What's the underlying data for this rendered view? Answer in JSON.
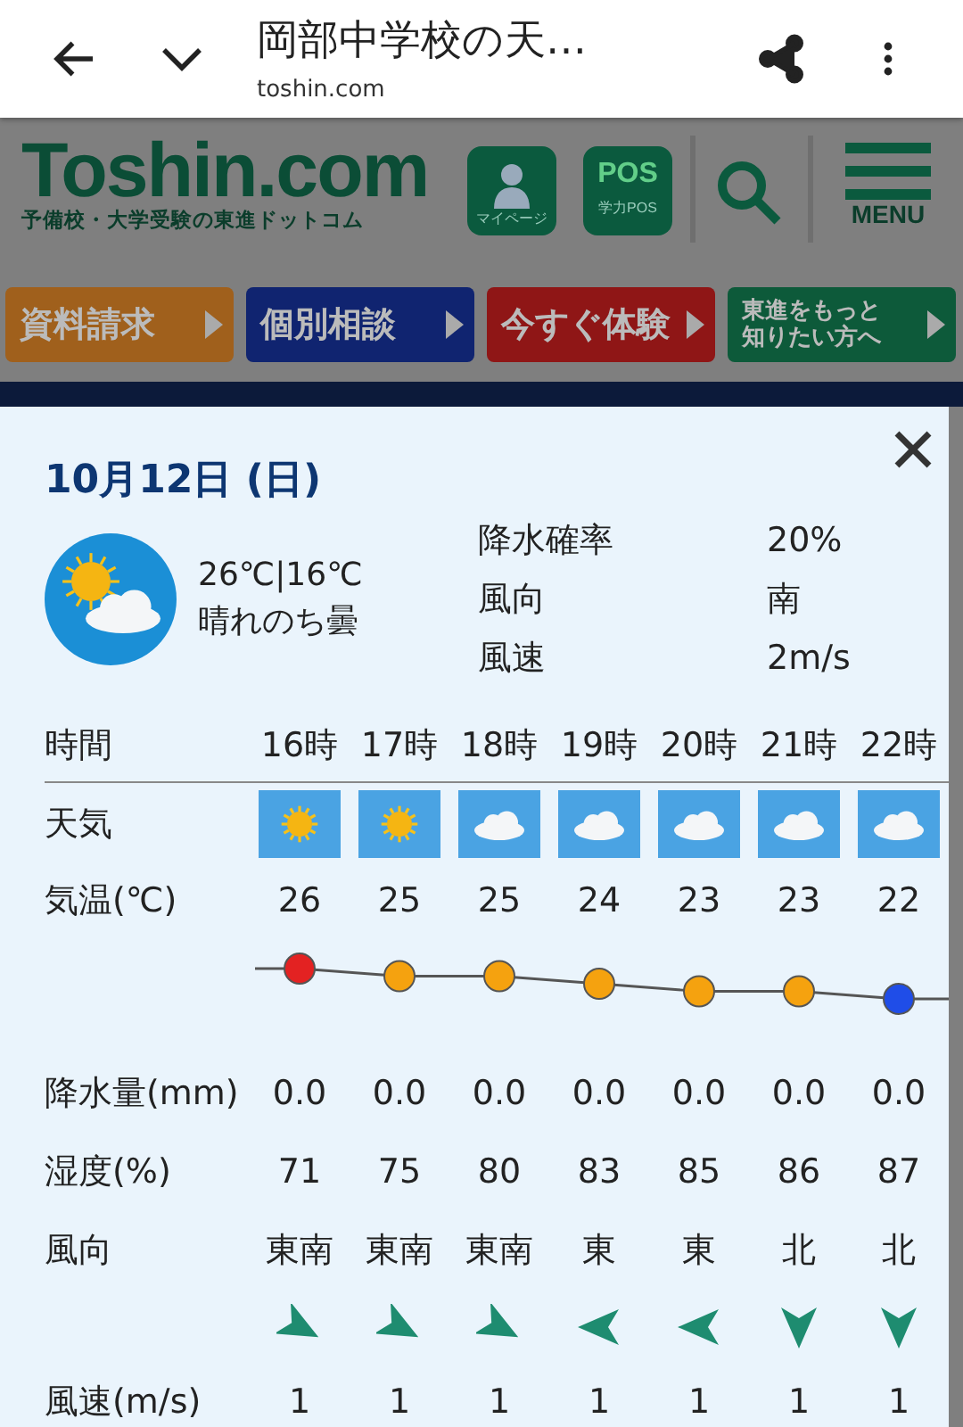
{
  "browser_bar": {
    "title": "岡部中学校の天…",
    "url": "toshin.com"
  },
  "site_header": {
    "logo": "Toshin.com",
    "tagline": "予備校・大学受験の東進ドットコム",
    "mypage": "マイページ",
    "pos_top": "POS",
    "pos_label": "学力POS",
    "menu": "MENU",
    "banners": [
      {
        "label": "資料請求",
        "color": "#a0601c"
      },
      {
        "label": "個別相談",
        "color": "#102470"
      },
      {
        "label": "今すぐ体験",
        "color": "#8f1616"
      },
      {
        "label": "東進をもっと知りたい方へ",
        "color": "#0d5a3a"
      }
    ]
  },
  "popup": {
    "date": "10月12日 (日)",
    "icon": {
      "kind": "sunny_then_cloudy"
    },
    "temps": "26℃|16℃",
    "weather": "晴れのち曇",
    "details": [
      {
        "label": "降水確率",
        "value": "20%"
      },
      {
        "label": "風向",
        "value": "南"
      },
      {
        "label": "風速",
        "value": "2m/s"
      }
    ],
    "labels": {
      "time": "時間",
      "weather": "天気",
      "temp": "気温(℃)",
      "rain": "降水量(mm)",
      "humidity": "湿度(%)",
      "wind_dir": "風向",
      "wind_speed": "風速(m/s)"
    },
    "hours": [
      {
        "time": "16時",
        "weather_icon": {
          "kind": "sunny"
        },
        "temp": "26",
        "color": "#e32222",
        "rain": "0.0",
        "humidity": "71",
        "wind_dir": "東南",
        "wind_arrow": {
          "kind": "southeast"
        },
        "wind_speed": "1"
      },
      {
        "time": "17時",
        "weather_icon": {
          "kind": "sunny"
        },
        "temp": "25",
        "color": "#f5a20f",
        "rain": "0.0",
        "humidity": "75",
        "wind_dir": "東南",
        "wind_arrow": {
          "kind": "southeast"
        },
        "wind_speed": "1"
      },
      {
        "time": "18時",
        "weather_icon": {
          "kind": "cloudy"
        },
        "temp": "25",
        "color": "#f5a20f",
        "rain": "0.0",
        "humidity": "80",
        "wind_dir": "東南",
        "wind_arrow": {
          "kind": "southeast"
        },
        "wind_speed": "1"
      },
      {
        "time": "19時",
        "weather_icon": {
          "kind": "cloudy"
        },
        "temp": "24",
        "color": "#f5a20f",
        "rain": "0.0",
        "humidity": "83",
        "wind_dir": "東",
        "wind_arrow": {
          "kind": "east"
        },
        "wind_speed": "1"
      },
      {
        "time": "20時",
        "weather_icon": {
          "kind": "cloudy"
        },
        "temp": "23",
        "color": "#f5a20f",
        "rain": "0.0",
        "humidity": "85",
        "wind_dir": "東",
        "wind_arrow": {
          "kind": "east"
        },
        "wind_speed": "1"
      },
      {
        "time": "21時",
        "weather_icon": {
          "kind": "cloudy"
        },
        "temp": "23",
        "color": "#f5a20f",
        "rain": "0.0",
        "humidity": "86",
        "wind_dir": "北",
        "wind_arrow": {
          "kind": "north"
        },
        "wind_speed": "1"
      },
      {
        "time": "22時",
        "weather_icon": {
          "kind": "cloudy"
        },
        "temp": "22",
        "color": "#1f4de8",
        "rain": "0.0",
        "humidity": "87",
        "wind_dir": "北",
        "wind_arrow": {
          "kind": "north"
        },
        "wind_speed": "1"
      }
    ]
  }
}
